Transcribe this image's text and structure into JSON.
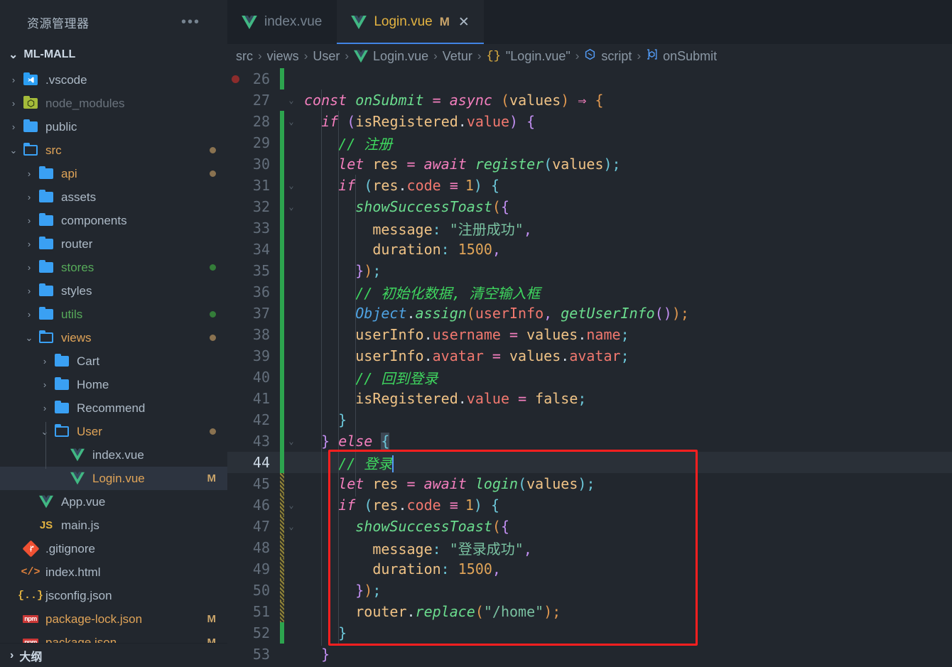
{
  "window": {
    "bg": "#22272e",
    "accent": "#4184e4"
  },
  "sidebar": {
    "title": "资源管理器",
    "more_label": "•••",
    "root": {
      "label": "ML-MALL",
      "expanded": true,
      "chevron": "⌄"
    },
    "outline": {
      "label": "大纲",
      "chevron": "›"
    },
    "items": [
      {
        "label": ".vscode",
        "icon": "folder-vscode-icon",
        "twist": "›",
        "indent": 1,
        "color": "#adbac7",
        "badge": "",
        "dot": ""
      },
      {
        "label": "node_modules",
        "icon": "folder-node-icon",
        "twist": "›",
        "indent": 1,
        "color": "#6a737d",
        "badge": "",
        "dot": ""
      },
      {
        "label": "public",
        "icon": "folder-icon",
        "twist": "›",
        "indent": 1,
        "color": "#adbac7",
        "badge": "",
        "dot": ""
      },
      {
        "label": "src",
        "icon": "folder-open-icon",
        "twist": "⌄",
        "indent": 1,
        "color": "#e0a458",
        "badge": "",
        "dot": "#8a7250"
      },
      {
        "label": "api",
        "icon": "folder-icon",
        "twist": "›",
        "indent": 2,
        "color": "#e0a458",
        "badge": "",
        "dot": "#8a7250"
      },
      {
        "label": "assets",
        "icon": "folder-icon",
        "twist": "›",
        "indent": 2,
        "color": "#adbac7",
        "badge": "",
        "dot": ""
      },
      {
        "label": "components",
        "icon": "folder-icon",
        "twist": "›",
        "indent": 2,
        "color": "#adbac7",
        "badge": "",
        "dot": ""
      },
      {
        "label": "router",
        "icon": "folder-icon",
        "twist": "›",
        "indent": 2,
        "color": "#adbac7",
        "badge": "",
        "dot": ""
      },
      {
        "label": "stores",
        "icon": "folder-icon",
        "twist": "›",
        "indent": 2,
        "color": "#57ab5a",
        "badge": "",
        "dot": "#347d39"
      },
      {
        "label": "styles",
        "icon": "folder-icon",
        "twist": "›",
        "indent": 2,
        "color": "#adbac7",
        "badge": "",
        "dot": ""
      },
      {
        "label": "utils",
        "icon": "folder-icon",
        "twist": "›",
        "indent": 2,
        "color": "#57ab5a",
        "badge": "",
        "dot": "#347d39"
      },
      {
        "label": "views",
        "icon": "folder-open-icon",
        "twist": "⌄",
        "indent": 2,
        "color": "#e0a458",
        "badge": "",
        "dot": "#8a7250"
      },
      {
        "label": "Cart",
        "icon": "folder-icon",
        "twist": "›",
        "indent": 3,
        "color": "#adbac7",
        "badge": "",
        "dot": ""
      },
      {
        "label": "Home",
        "icon": "folder-icon",
        "twist": "›",
        "indent": 3,
        "color": "#adbac7",
        "badge": "",
        "dot": ""
      },
      {
        "label": "Recommend",
        "icon": "folder-icon",
        "twist": "›",
        "indent": 3,
        "color": "#adbac7",
        "badge": "",
        "dot": ""
      },
      {
        "label": "User",
        "icon": "folder-open-icon",
        "twist": "⌄",
        "indent": 3,
        "color": "#e0a458",
        "badge": "",
        "dot": "#8a7250"
      },
      {
        "label": "index.vue",
        "icon": "vue-icon",
        "twist": "",
        "indent": 4,
        "color": "#adbac7",
        "badge": "",
        "dot": ""
      },
      {
        "label": "Login.vue",
        "icon": "vue-icon",
        "twist": "",
        "indent": 4,
        "color": "#e0a458",
        "badge": "M",
        "dot": "",
        "selected": true
      },
      {
        "label": "App.vue",
        "icon": "vue-icon",
        "twist": "",
        "indent": 2,
        "color": "#adbac7",
        "badge": "",
        "dot": ""
      },
      {
        "label": "main.js",
        "icon": "js-icon",
        "twist": "",
        "indent": 2,
        "color": "#adbac7",
        "badge": "",
        "dot": ""
      },
      {
        "label": ".gitignore",
        "icon": "git-icon",
        "twist": "",
        "indent": 1,
        "color": "#adbac7",
        "badge": "",
        "dot": ""
      },
      {
        "label": "index.html",
        "icon": "html-icon",
        "twist": "",
        "indent": 1,
        "color": "#adbac7",
        "badge": "",
        "dot": ""
      },
      {
        "label": "jsconfig.json",
        "icon": "json-icon",
        "twist": "",
        "indent": 1,
        "color": "#adbac7",
        "badge": "",
        "dot": ""
      },
      {
        "label": "package-lock.json",
        "icon": "npm-icon",
        "twist": "",
        "indent": 1,
        "color": "#e0a458",
        "badge": "M",
        "dot": ""
      },
      {
        "label": "package.json",
        "icon": "npm-icon",
        "twist": "",
        "indent": 1,
        "color": "#e0a458",
        "badge": "M",
        "dot": ""
      }
    ]
  },
  "tabs": [
    {
      "label": "index.vue",
      "icon": "vue-icon",
      "modified": "",
      "active": false,
      "closable": false
    },
    {
      "label": "Login.vue",
      "icon": "vue-icon",
      "modified": "M",
      "active": true,
      "closable": true,
      "close": "✕"
    }
  ],
  "breadcrumb": {
    "separator": "›",
    "segments": [
      {
        "label": "src",
        "icon": ""
      },
      {
        "label": "views",
        "icon": ""
      },
      {
        "label": "User",
        "icon": ""
      },
      {
        "label": "Login.vue",
        "icon": "vue-icon"
      },
      {
        "label": "Vetur",
        "icon": ""
      },
      {
        "label": "\"Login.vue\"",
        "icon": "json-braces-icon"
      },
      {
        "label": "script",
        "icon": "symbol-module-icon"
      },
      {
        "label": "onSubmit",
        "icon": "symbol-function-icon"
      }
    ]
  },
  "editor": {
    "first_line": 26,
    "active_line": 44,
    "breakpoint_line": 26,
    "highlight_box": {
      "color": "#ff1f1f",
      "from_line": 44,
      "to_line": 52
    },
    "lines": [
      {
        "n": 26,
        "git": "add",
        "fold": "",
        "text": ""
      },
      {
        "n": 27,
        "git": "none",
        "fold": "⌄",
        "text": "const onSubmit = async (values) => {"
      },
      {
        "n": 28,
        "git": "add",
        "fold": "⌄",
        "text": "  if (isRegistered.value) {"
      },
      {
        "n": 29,
        "git": "add",
        "fold": "",
        "text": "    // 注册"
      },
      {
        "n": 30,
        "git": "add",
        "fold": "",
        "text": "    let res = await register(values);"
      },
      {
        "n": 31,
        "git": "add",
        "fold": "⌄",
        "text": "    if (res.code === 1) {"
      },
      {
        "n": 32,
        "git": "add",
        "fold": "⌄",
        "text": "      showSuccessToast({"
      },
      {
        "n": 33,
        "git": "add",
        "fold": "",
        "text": "        message: \"注册成功\","
      },
      {
        "n": 34,
        "git": "add",
        "fold": "",
        "text": "        duration: 1500,"
      },
      {
        "n": 35,
        "git": "add",
        "fold": "",
        "text": "      });"
      },
      {
        "n": 36,
        "git": "add",
        "fold": "",
        "text": "      // 初始化数据, 清空输入框"
      },
      {
        "n": 37,
        "git": "add",
        "fold": "",
        "text": "      Object.assign(userInfo, getUserInfo());"
      },
      {
        "n": 38,
        "git": "add",
        "fold": "",
        "text": "      userInfo.username = values.name;"
      },
      {
        "n": 39,
        "git": "add",
        "fold": "",
        "text": "      userInfo.avatar = values.avatar;"
      },
      {
        "n": 40,
        "git": "add",
        "fold": "",
        "text": "      // 回到登录"
      },
      {
        "n": 41,
        "git": "add",
        "fold": "",
        "text": "      isRegistered.value = false;"
      },
      {
        "n": 42,
        "git": "add",
        "fold": "",
        "text": "    }"
      },
      {
        "n": 43,
        "git": "add",
        "fold": "⌄",
        "text": "  } else {"
      },
      {
        "n": 44,
        "git": "add",
        "fold": "",
        "text": "    // 登录"
      },
      {
        "n": 45,
        "git": "mod",
        "fold": "",
        "text": "    let res = await login(values);"
      },
      {
        "n": 46,
        "git": "mod",
        "fold": "⌄",
        "text": "    if (res.code === 1) {"
      },
      {
        "n": 47,
        "git": "mod",
        "fold": "⌄",
        "text": "      showSuccessToast({"
      },
      {
        "n": 48,
        "git": "mod",
        "fold": "",
        "text": "        message: \"登录成功\","
      },
      {
        "n": 49,
        "git": "mod",
        "fold": "",
        "text": "        duration: 1500,"
      },
      {
        "n": 50,
        "git": "mod",
        "fold": "",
        "text": "      });"
      },
      {
        "n": 51,
        "git": "mod",
        "fold": "",
        "text": "      router.replace(\"/home\");"
      },
      {
        "n": 52,
        "git": "add",
        "fold": "",
        "text": "    }"
      },
      {
        "n": 53,
        "git": "none",
        "fold": "",
        "text": "  }"
      }
    ]
  }
}
